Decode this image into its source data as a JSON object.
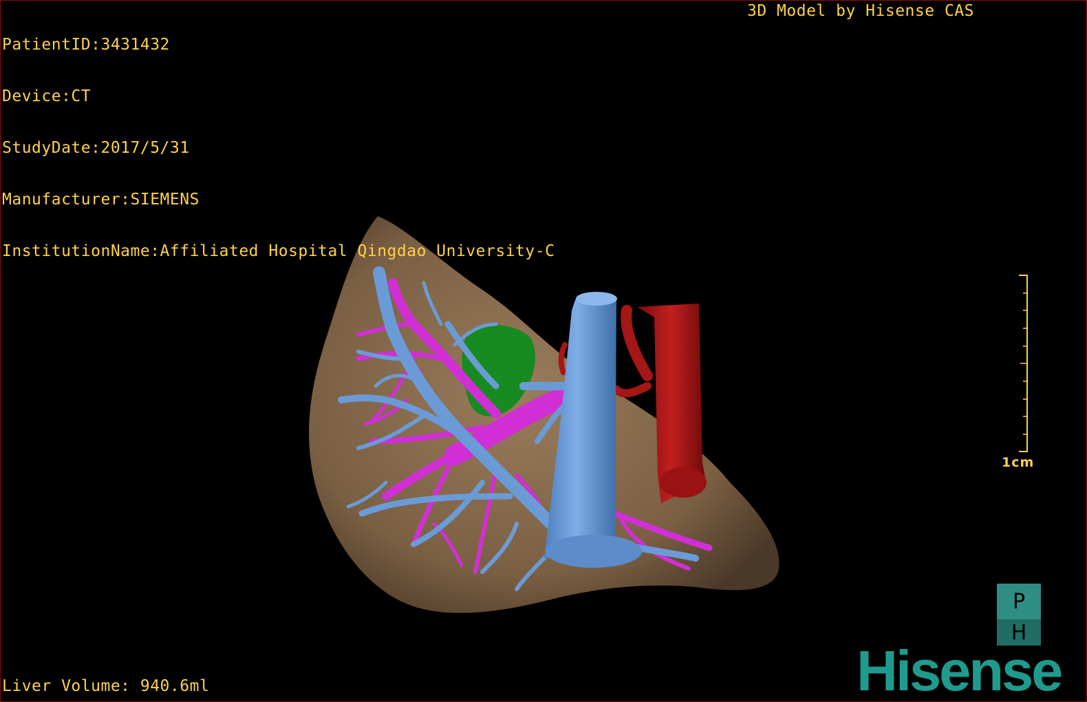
{
  "header": {
    "patient_id": "PatientID:3431432",
    "device": "Device:CT",
    "study_date": "StudyDate:2017/5/31",
    "manufacturer": "Manufacturer:SIEMENS",
    "institution": "InstitutionName:Affiliated Hospital Qingdao University-C",
    "title_right": "3D Model by Hisense CAS"
  },
  "footer": {
    "liver_volume": "Liver Volume: 940.6ml"
  },
  "scale": {
    "label": "1cm"
  },
  "orientation_cube": {
    "top_face": "P",
    "bottom_face": "H"
  },
  "brand": {
    "logo_text": "Hisense"
  },
  "colors": {
    "overlay_text": "#ffd24a",
    "liver": "#8a6d4e",
    "portal_vein": "#6b9bd6",
    "hepatic_vein": "#d12fd6",
    "gallbladder": "#178a22",
    "aorta": "#b01818",
    "brand": "#1f9b8e"
  },
  "structures": [
    {
      "name": "liver",
      "icon": "liver-surface-icon"
    },
    {
      "name": "portal-vein",
      "icon": "vessel-tree-icon"
    },
    {
      "name": "hepatic-vein",
      "icon": "vessel-tree-icon"
    },
    {
      "name": "gallbladder",
      "icon": "organ-icon"
    },
    {
      "name": "aorta",
      "icon": "vessel-icon"
    },
    {
      "name": "inferior-vena-cava",
      "icon": "vessel-icon"
    }
  ]
}
